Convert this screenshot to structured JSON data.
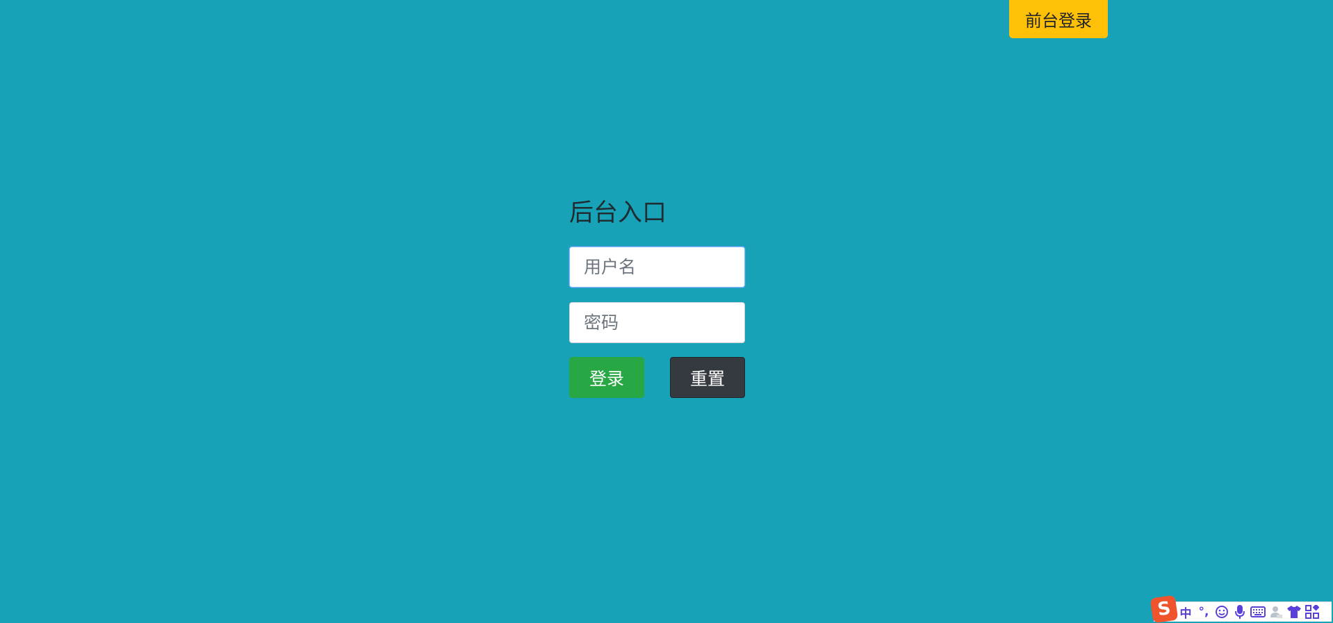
{
  "header": {
    "front_login_label": "前台登录"
  },
  "login_form": {
    "title": "后台入口",
    "username_placeholder": "用户名",
    "password_placeholder": "密码",
    "login_label": "登录",
    "reset_label": "重置"
  },
  "ime_toolbar": {
    "mode_label": "中",
    "punctuation_label": "°,",
    "icons": [
      "sogou-logo-icon",
      "emoji-icon",
      "microphone-icon",
      "keyboard-icon",
      "user-icon",
      "skin-icon",
      "toolbox-icon"
    ]
  },
  "colors": {
    "background": "#17a2b8",
    "front_login_button": "#ffc107",
    "login_button": "#28a745",
    "reset_button": "#343a40",
    "ime_accent": "#5a40d8",
    "ime_logo": "#f0542d"
  }
}
